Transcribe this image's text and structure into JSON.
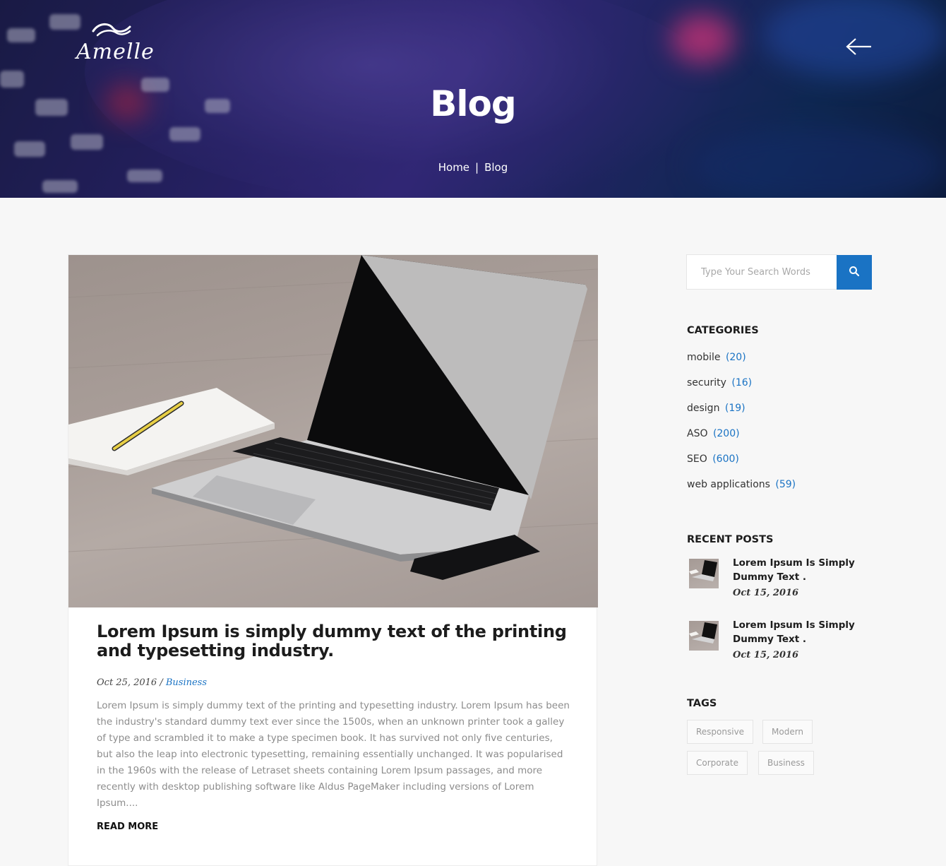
{
  "brand": {
    "logo_text": "Amelle"
  },
  "hero": {
    "title": "Blog",
    "breadcrumb": {
      "home": "Home",
      "separator": "|",
      "current": "Blog"
    }
  },
  "post": {
    "title": "Lorem Ipsum is simply dummy text of the printing and typesetting industry.",
    "date": "Oct 25, 2016",
    "meta_separator": "/",
    "category": "Business",
    "excerpt": "Lorem Ipsum is simply dummy text of the printing and typesetting industry. Lorem Ipsum has been the industry's standard dummy text ever since the 1500s, when an unknown printer took a galley of type and scrambled it to make a type specimen book. It has survived not only five centuries, but also the leap into electronic typesetting, remaining essentially unchanged. It was popularised in the 1960s with the release of Letraset sheets containing Lorem Ipsum passages, and more recently with desktop publishing software like Aldus PageMaker including versions of Lorem Ipsum....",
    "read_more": "READ MORE"
  },
  "sidebar": {
    "search": {
      "placeholder": "Type Your Search Words"
    },
    "categories": {
      "title": "CATEGORIES",
      "items": [
        {
          "name": "mobile",
          "count": "(20)"
        },
        {
          "name": "security",
          "count": "(16)"
        },
        {
          "name": "design",
          "count": "(19)"
        },
        {
          "name": "ASO",
          "count": "(200)"
        },
        {
          "name": "SEO",
          "count": "(600)"
        },
        {
          "name": "web applications",
          "count": "(59)"
        }
      ]
    },
    "recent_posts": {
      "title": "RECENT POSTS",
      "items": [
        {
          "title": "Lorem Ipsum Is Simply Dummy Text .",
          "date": "Oct 15, 2016"
        },
        {
          "title": "Lorem Ipsum Is Simply Dummy Text .",
          "date": "Oct 15, 2016"
        }
      ]
    },
    "tags": {
      "title": "TAGS",
      "items": [
        "Responsive",
        "Modern",
        "Corporate",
        "Business"
      ]
    }
  },
  "colors": {
    "accent": "#1a73c4",
    "page_background": "#f7f7f7",
    "hero_overlay": "#2b2470"
  },
  "icons": [
    "logo-wave-icon",
    "back-arrow-icon",
    "search-icon"
  ]
}
